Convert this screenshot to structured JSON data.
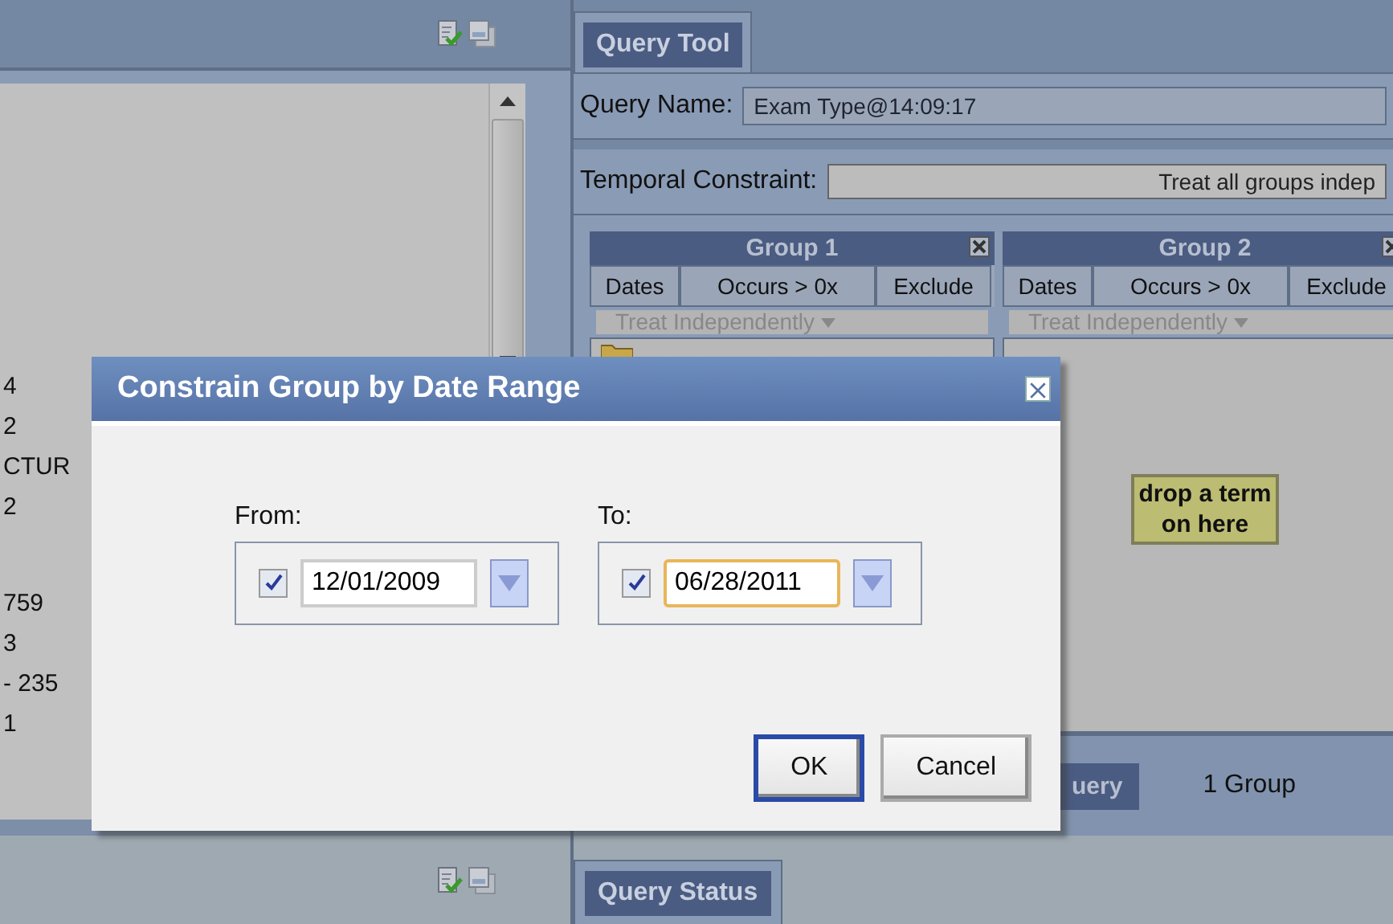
{
  "left_panel": {
    "list_items": [
      "4",
      "2",
      "CTUR",
      "2",
      "759",
      "3",
      "- 235",
      "1"
    ]
  },
  "query_tool": {
    "tab": {
      "label": "Query Tool",
      "selected": true
    },
    "query_name": {
      "label": "Query Name:",
      "value": "Exam Type@14:09:17"
    },
    "temporal_constraint": {
      "label": "Temporal Constraint:",
      "value": "Treat all groups indep"
    },
    "groups": [
      {
        "title": "Group 1",
        "columns": [
          "Dates",
          "Occurs > 0x",
          "Exclude"
        ],
        "timing": "Treat Independently",
        "kind": "filled"
      },
      {
        "title": "Group 2",
        "columns": [
          "Dates",
          "Occurs > 0x",
          "Exclude"
        ],
        "timing": "Treat Independently",
        "kind": "empty",
        "drop_hint": "drop a term on here"
      }
    ],
    "footer": {
      "run_button": "uery",
      "group_count": "1 Group"
    }
  },
  "status_tab": {
    "label": "Query Status",
    "selected": true
  },
  "dialog": {
    "title": "Constrain Group by Date Range",
    "fields": [
      {
        "label": "From:",
        "checked": true,
        "value": "12/01/2009",
        "focused": false
      },
      {
        "label": "To:",
        "checked": true,
        "value": "06/28/2011",
        "focused": true
      }
    ],
    "buttons": [
      {
        "label": "OK",
        "default": true
      },
      {
        "label": "Cancel",
        "default": false
      }
    ]
  }
}
